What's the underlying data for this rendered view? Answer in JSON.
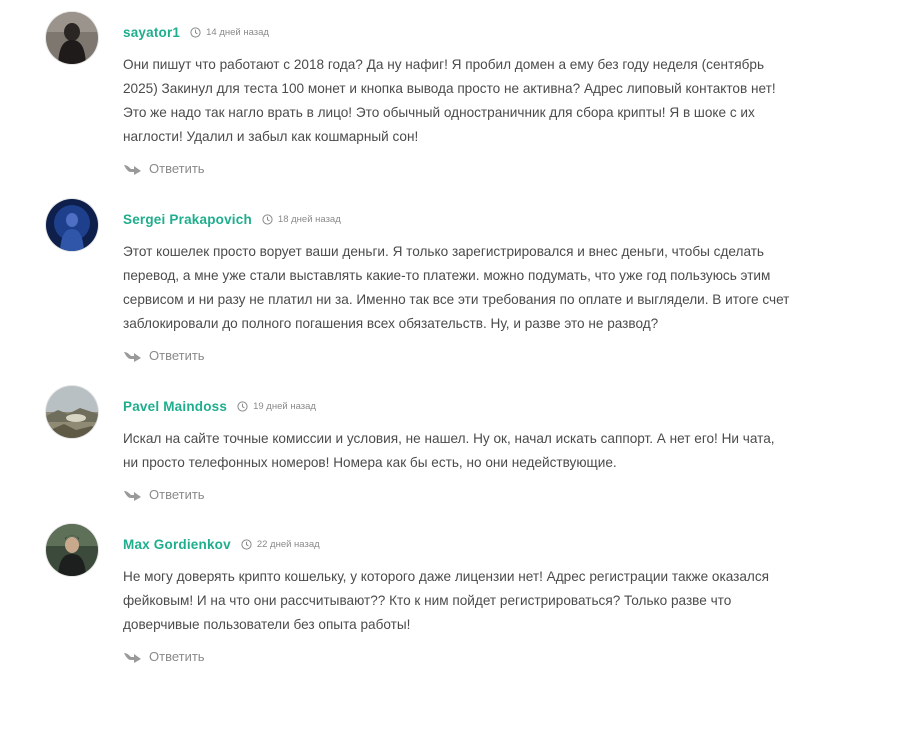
{
  "comments": [
    {
      "author": "sayator1",
      "date": "14 дней назад",
      "text": "Они пишут что работают с 2018 года? Да ну нафиг! Я пробил домен а ему без году неделя (сентябрь 2025) Закинул для теста 100 монет и кнопка вывода просто не активна? Адрес липовый контактов нет! Это же надо так нагло врать в лицо! Это обычный одностраничник для сбора крипты! Я в шоке с их наглости! Удалил и забыл как кошмарный сон!",
      "reply_label": "Ответить"
    },
    {
      "author": "Sergei Prakapovich",
      "date": "18 дней назад",
      "text": "Этот кошелек просто ворует ваши деньги. Я только зарегистрировался и внес деньги, чтобы сделать перевод, а мне уже стали выставлять какие-то платежи. можно подумать, что уже год пользуюсь этим сервисом и ни разу не платил ни за. Именно так все эти требования по оплате и выглядели. В итоге счет заблокировали до полного погашения всех обязательств. Ну, и разве это не развод?",
      "reply_label": "Ответить"
    },
    {
      "author": "Pavel Maindoss",
      "date": "19 дней назад",
      "text": "Искал на сайте точные комиссии и условия, не нашел. Ну ок, начал искать саппорт. А нет его! Ни чата, ни просто телефонных номеров! Номера как бы есть, но они недействующие.",
      "reply_label": "Ответить"
    },
    {
      "author": "Max Gordienkov",
      "date": "22 дней назад",
      "text": "Не могу доверять крипто кошельку, у которого даже лицензии нет! Адрес регистрации также оказался фейковым! И на что они рассчитывают?? Кто к ним пойдет регистрироваться? Только разве что доверчивые пользователи без опыта работы!",
      "reply_label": "Ответить"
    }
  ],
  "colors": {
    "author": "#1fae8d",
    "text": "#4b4b4b",
    "meta": "#8a8a8a"
  },
  "icons": {
    "date": "clock-icon",
    "reply": "reply-arrow-icon"
  }
}
